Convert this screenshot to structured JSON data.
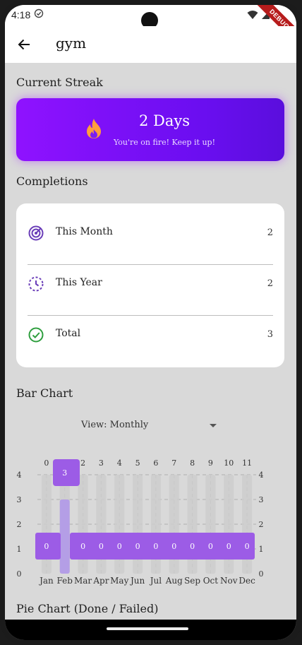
{
  "status_bar": {
    "time": "4:18",
    "debug_label": "DEBUG"
  },
  "app_bar": {
    "title": "gym"
  },
  "streak": {
    "section_title": "Current Streak",
    "days_text": "2 Days",
    "message": "You're on fire! Keep it up!"
  },
  "completions": {
    "section_title": "Completions",
    "rows": [
      {
        "label": "This Month",
        "value": "2",
        "icon": "target-icon",
        "color": "#6a3db8"
      },
      {
        "label": "This Year",
        "value": "2",
        "icon": "calendar-clock-icon",
        "color": "#6a3db8"
      },
      {
        "label": "Total",
        "value": "3",
        "icon": "check-circle-icon",
        "color": "#2e9e3e"
      }
    ]
  },
  "bar_chart": {
    "section_title": "Bar Chart",
    "view_label": "View: Monthly"
  },
  "pie_chart": {
    "section_title": "Pie Chart (Done / Failed)"
  },
  "chart_data": {
    "type": "bar",
    "categories": [
      "Jan",
      "Feb",
      "Mar",
      "Apr",
      "May",
      "Jun",
      "Jul",
      "Aug",
      "Sep",
      "Oct",
      "Nov",
      "Dec"
    ],
    "values": [
      0,
      3,
      0,
      0,
      0,
      0,
      0,
      0,
      0,
      0,
      0,
      0
    ],
    "top_labels": [
      "0",
      "1",
      "2",
      "3",
      "4",
      "5",
      "6",
      "7",
      "8",
      "9",
      "10",
      "11"
    ],
    "yticks": [
      "0",
      "1",
      "2",
      "3",
      "4"
    ],
    "ylim": [
      0,
      4
    ],
    "grid": true,
    "colors": {
      "bar": "#b49ee6",
      "track": "#cccccc",
      "tooltip": "#9c5ce6",
      "grid": "#b0b0b0"
    }
  }
}
